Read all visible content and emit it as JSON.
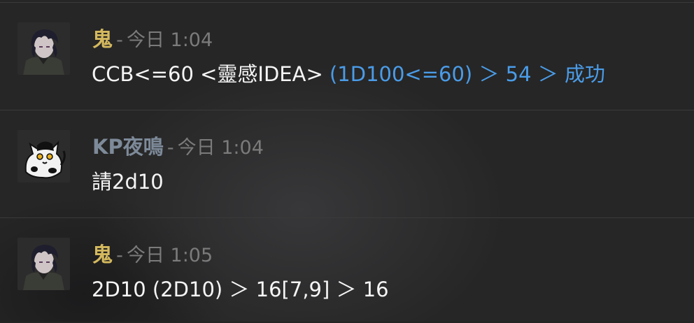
{
  "messages": [
    {
      "author": "鬼",
      "author_color": "#d4b95e",
      "separator": "-",
      "time": "今日 1:04",
      "avatar_icon": "dark-haired-character-avatar",
      "text_plain": "CCB<=60 <靈感IDEA>",
      "text_roll": "(1D100<=60) ＞ 54 ＞ 成功"
    },
    {
      "author": "KP夜鳴",
      "author_color": "#7d8a99",
      "separator": "-",
      "time": "今日 1:04",
      "avatar_icon": "black-white-cat-avatar",
      "text_plain": "請2d10",
      "text_roll": ""
    },
    {
      "author": "鬼",
      "author_color": "#d4b95e",
      "separator": "-",
      "time": "今日 1:05",
      "avatar_icon": "dark-haired-character-avatar",
      "text_plain": "2D10 (2D10) ＞ 16[7,9] ＞ 16",
      "text_roll": ""
    }
  ]
}
